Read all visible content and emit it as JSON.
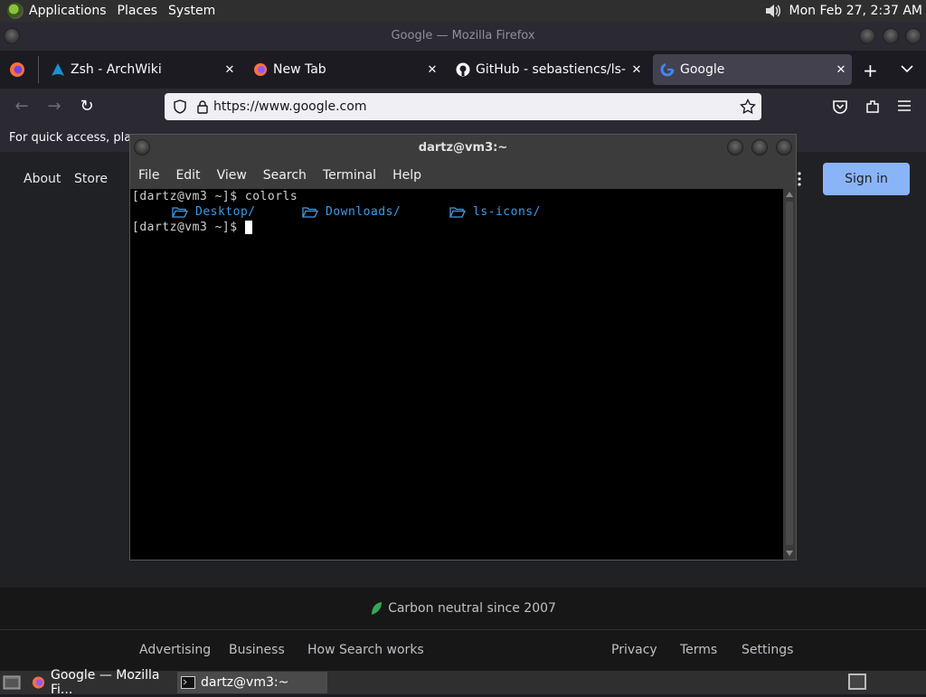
{
  "top_panel": {
    "menus": [
      "Applications",
      "Places",
      "System"
    ],
    "clock": "Mon Feb 27,  2:37 AM"
  },
  "firefox": {
    "window_title": "Google — Mozilla Firefox",
    "tabs": [
      {
        "label": "Zsh - ArchWiki",
        "icon": "archwiki-icon"
      },
      {
        "label": "New Tab",
        "icon": "firefox-icon"
      },
      {
        "label": "GitHub - sebastiencs/ls-icons",
        "icon": "github-icon"
      },
      {
        "label": "Google",
        "icon": "google-icon",
        "active": true
      }
    ],
    "url": "https://www.google.com",
    "bookmarks_hint": "For quick access, place"
  },
  "google": {
    "top_links": [
      "About",
      "Store"
    ],
    "sign_in": "Sign in",
    "carbon_neutral": "Carbon neutral since 2007",
    "footer_left": [
      "Advertising",
      "Business",
      "How Search works"
    ],
    "footer_right": [
      "Privacy",
      "Terms",
      "Settings"
    ]
  },
  "terminal": {
    "title": "dartz@vm3:~",
    "menus": [
      "File",
      "Edit",
      "View",
      "Search",
      "Terminal",
      "Help"
    ],
    "prompt": "[dartz@vm3 ~]$ ",
    "command": "colorls",
    "dirs": [
      "Desktop/",
      "Downloads/",
      "ls-icons/"
    ]
  },
  "taskbar": {
    "tasks": [
      "Google — Mozilla Fi...",
      "dartz@vm3:~"
    ]
  },
  "colors": {
    "accent_blue": "#8ab4f8",
    "dir_blue": "#3d9be9",
    "terminal_bg": "#000000"
  }
}
